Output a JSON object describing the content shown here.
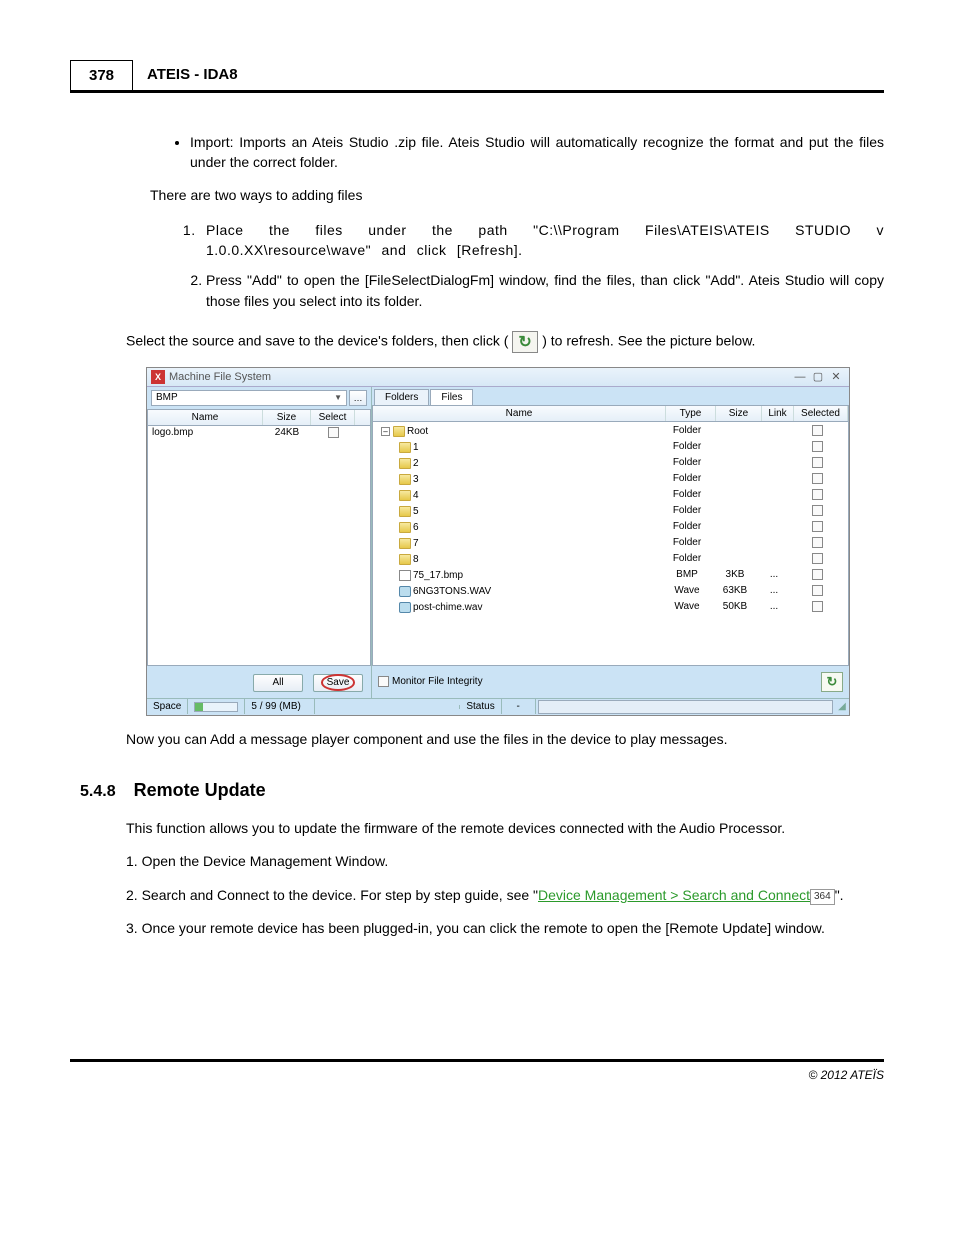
{
  "header": {
    "page_number": "378",
    "doc_title": "ATEIS - IDA8"
  },
  "intro": {
    "bullet1": "Import: Imports an Ateis Studio .zip file. Ateis Studio will automatically recognize the format and put the files under the correct folder.",
    "two_ways": "There are two ways to adding files",
    "step1": "Place the files under the path \"C:\\\\Program Files\\ATEIS\\ATEIS STUDIO v 1.0.0.XX\\resource\\wave\" and click [Refresh].",
    "step2": "Press \"Add\" to open the [FileSelectDialogFm] window, find the files, than click \"Add\". Ateis Studio will copy those files you select into its folder.",
    "select_source_a": "Select the source and save to the device's folders, then click (",
    "select_source_b": ") to refresh. See the picture below."
  },
  "screenshot": {
    "title": "Machine File System",
    "left": {
      "combo_value": "BMP",
      "columns": {
        "name": "Name",
        "size": "Size",
        "select": "Select"
      },
      "rows": [
        {
          "name": "logo.bmp",
          "size": "24KB"
        }
      ],
      "btn_all": "All",
      "btn_save": "Save"
    },
    "right": {
      "tabs": {
        "folders": "Folders",
        "files": "Files"
      },
      "columns": {
        "name": "Name",
        "type": "Type",
        "size": "Size",
        "link": "Link",
        "selected": "Selected"
      },
      "root_label": "Root",
      "rows": [
        {
          "name": "1",
          "type": "Folder",
          "size": "",
          "link": "",
          "kind": "folder"
        },
        {
          "name": "2",
          "type": "Folder",
          "size": "",
          "link": "",
          "kind": "folder"
        },
        {
          "name": "3",
          "type": "Folder",
          "size": "",
          "link": "",
          "kind": "folder"
        },
        {
          "name": "4",
          "type": "Folder",
          "size": "",
          "link": "",
          "kind": "folder"
        },
        {
          "name": "5",
          "type": "Folder",
          "size": "",
          "link": "",
          "kind": "folder"
        },
        {
          "name": "6",
          "type": "Folder",
          "size": "",
          "link": "",
          "kind": "folder"
        },
        {
          "name": "7",
          "type": "Folder",
          "size": "",
          "link": "",
          "kind": "folder"
        },
        {
          "name": "8",
          "type": "Folder",
          "size": "",
          "link": "",
          "kind": "folder"
        },
        {
          "name": "75_17.bmp",
          "type": "BMP",
          "size": "3KB",
          "link": "...",
          "kind": "bmp"
        },
        {
          "name": "6NG3TONS.WAV",
          "type": "Wave",
          "size": "63KB",
          "link": "...",
          "kind": "wave"
        },
        {
          "name": "post-chime.wav",
          "type": "Wave",
          "size": "50KB",
          "link": "...",
          "kind": "wave"
        }
      ],
      "monitor_label": "Monitor File Integrity"
    },
    "statusbar": {
      "space_label": "Space",
      "space_value": "5 / 99 (MB)",
      "status_label": "Status",
      "status_value": "-"
    }
  },
  "after_screenshot": "Now you can Add a message player component and use the files in the device to play messages.",
  "section": {
    "number": "5.4.8",
    "title": "Remote Update",
    "intro": "This function allows you to update the firmware of the remote devices connected with the Audio Processor.",
    "step1": "1. Open the Device Management Window.",
    "step2_a": "2. Search and Connect to the device. For step by step guide, see \"",
    "step2_link": "Device Management > Search and Connect",
    "step2_ref": "364",
    "step2_b": "\".",
    "step3": "3. Once your remote device has been plugged-in, you can click the remote to open the [Remote Update] window."
  },
  "footer": "© 2012 ATEÏS"
}
